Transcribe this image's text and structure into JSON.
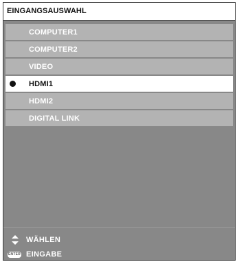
{
  "window": {
    "title": "EINGANGSAUSWAHL"
  },
  "menu": {
    "selected_index": 3,
    "items": [
      {
        "label": "COMPUTER1",
        "selected": false
      },
      {
        "label": "COMPUTER2",
        "selected": false
      },
      {
        "label": "VIDEO",
        "selected": false
      },
      {
        "label": "HDMI1",
        "selected": true
      },
      {
        "label": "HDMI2",
        "selected": false
      },
      {
        "label": "DIGITAL LINK",
        "selected": false
      }
    ]
  },
  "footer": {
    "select_icon": "up-down-arrows-icon",
    "select_label": "WÄHLEN",
    "enter_icon": "enter-key-icon",
    "enter_icon_text": "ENTER",
    "enter_label": "EINGABE"
  },
  "colors": {
    "panel_background": "#888888",
    "item_background": "#b3b3b3",
    "selected_background": "#ffffff",
    "text_light": "#ffffff",
    "text_dark": "#111111"
  }
}
